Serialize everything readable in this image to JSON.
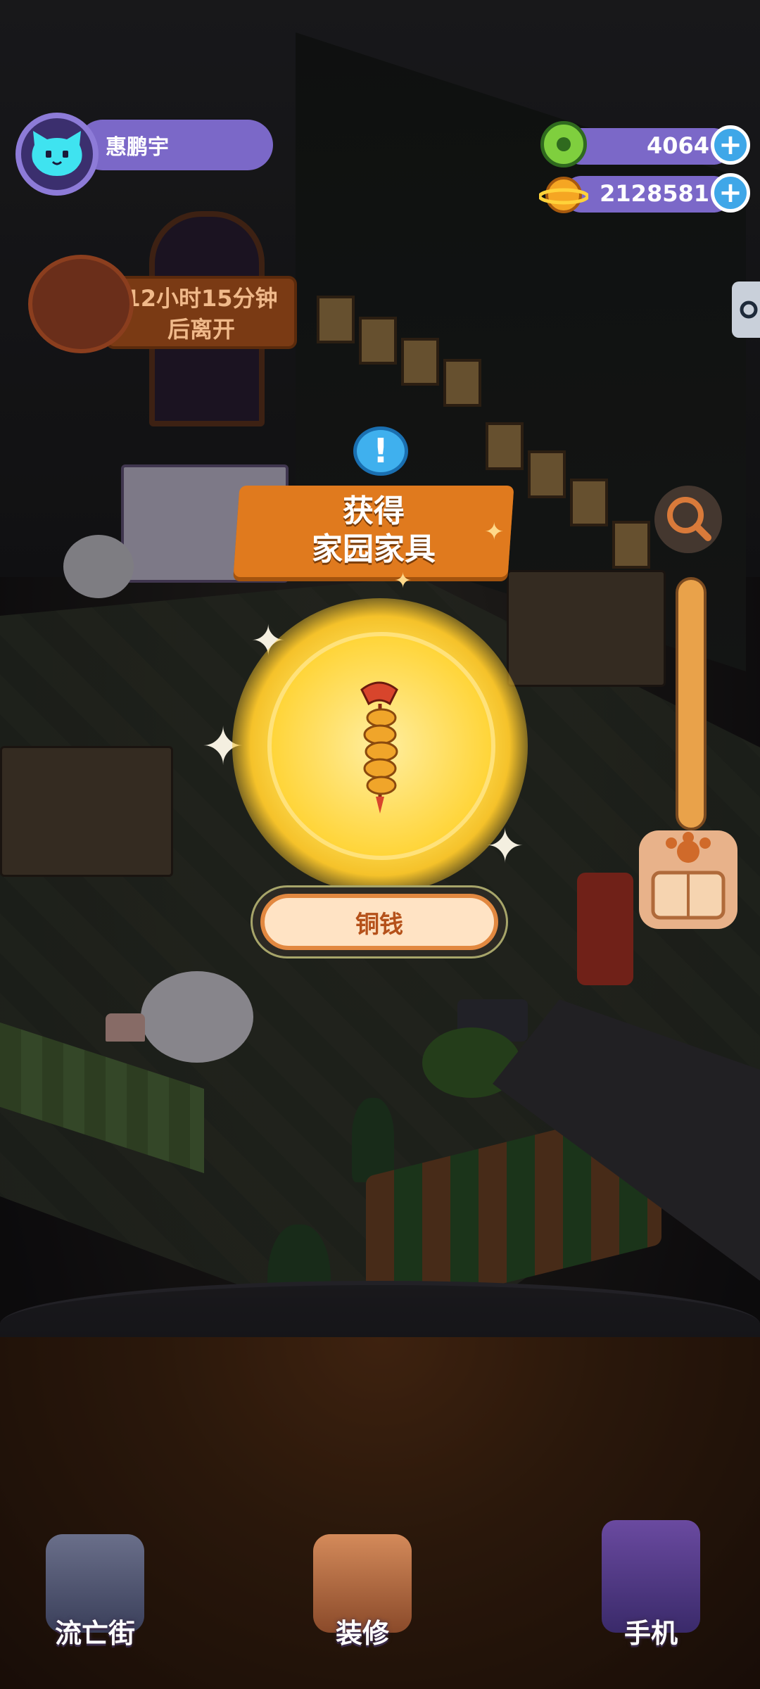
{
  "player": {
    "name": "惠鹏宇"
  },
  "currency": [
    {
      "value": "4064",
      "icon": "green-donut-coin-icon",
      "color": "#7fcf3e"
    },
    {
      "value": "2128581",
      "icon": "orange-planet-coin-icon",
      "color": "#f5a623"
    }
  ],
  "visitor": {
    "timer": "12小时15分钟后离开"
  },
  "reward": {
    "banner_line1": "获得",
    "banner_line2": "家园家具",
    "item_name": "铜钱",
    "item_icon": "copper-coin-string-icon"
  },
  "nav": [
    {
      "label": "流亡街",
      "icon": "street-icon"
    },
    {
      "label": "装修",
      "icon": "decorate-icon"
    },
    {
      "label": "手机",
      "icon": "phone-icon"
    }
  ],
  "colors": {
    "accent": "#7b68c8",
    "banner": "#e07a1e",
    "glow": "#ffd53a",
    "button_text": "#b5511a"
  }
}
